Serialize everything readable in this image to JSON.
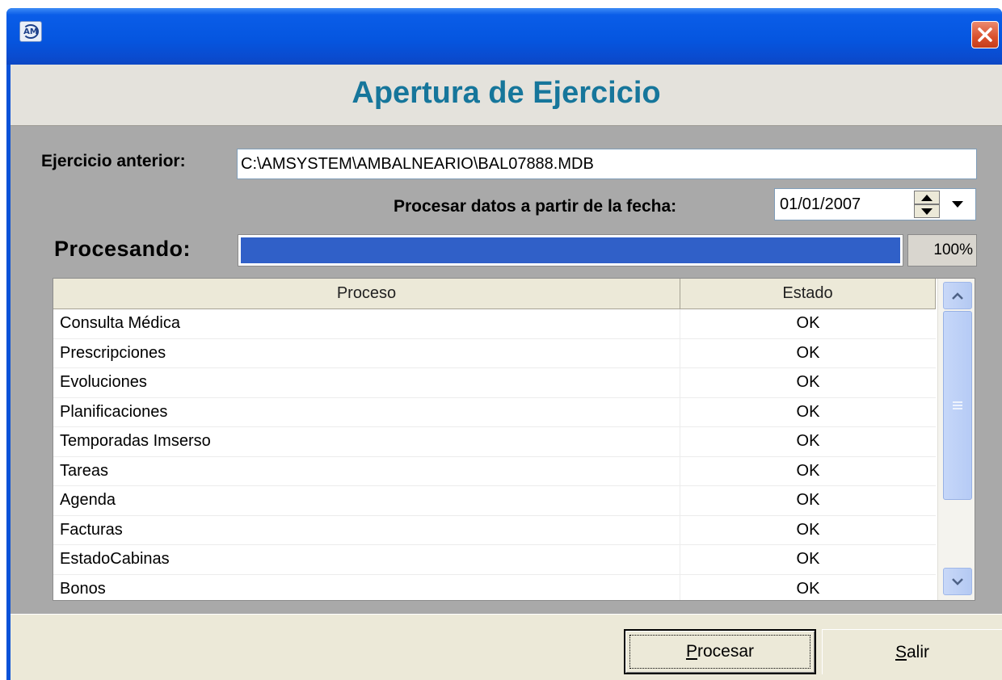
{
  "window": {
    "icon_label": "AM",
    "close_icon": "close-x-icon",
    "close_color": "#d9502c",
    "titlebar_color": "#0556e0"
  },
  "header": {
    "title": "Apertura de Ejercicio",
    "title_color": "#16769b"
  },
  "form": {
    "ejercicio_label": "Ejercicio anterior:",
    "ejercicio_value": "C:\\AMSYSTEM\\AMBALNEARIO\\BAL07888.MDB",
    "fecha_label": "Procesar datos a partir de la fecha:",
    "fecha_value": "01/01/2007",
    "procesando_label": "Procesando:",
    "progress_percent": 100,
    "progress_text": "100%",
    "progress_color": "#3060c8"
  },
  "grid": {
    "columns": [
      "Proceso",
      "Estado"
    ],
    "rows": [
      {
        "proceso": "Consulta Médica",
        "estado": "OK"
      },
      {
        "proceso": "Prescripciones",
        "estado": "OK"
      },
      {
        "proceso": "Evoluciones",
        "estado": "OK"
      },
      {
        "proceso": "Planificaciones",
        "estado": "OK"
      },
      {
        "proceso": "Temporadas Imserso",
        "estado": "OK"
      },
      {
        "proceso": "Tareas",
        "estado": "OK"
      },
      {
        "proceso": "Agenda",
        "estado": "OK"
      },
      {
        "proceso": "Facturas",
        "estado": "OK"
      },
      {
        "proceso": "EstadoCabinas",
        "estado": "OK"
      },
      {
        "proceso": "Bonos",
        "estado": "OK"
      }
    ]
  },
  "buttons": {
    "procesar_accel": "P",
    "procesar_rest": "rocesar",
    "salir_accel": "S",
    "salir_rest": "alir"
  }
}
